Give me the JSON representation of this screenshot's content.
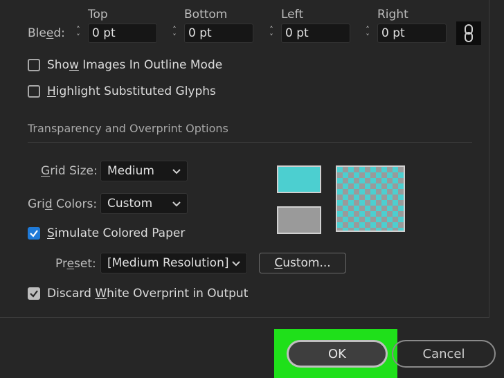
{
  "bleed": {
    "label": "Bleed:",
    "columns": [
      {
        "header": "Top",
        "value": "0 pt"
      },
      {
        "header": "Bottom",
        "value": "0 pt"
      },
      {
        "header": "Left",
        "value": "0 pt"
      },
      {
        "header": "Right",
        "value": "0 pt"
      }
    ],
    "link_icon": "chain-link-icon"
  },
  "options": {
    "show_images": {
      "label": "Show Images In Outline Mode",
      "checked": false
    },
    "highlight_glyphs": {
      "label": "Highlight Substituted Glyphs",
      "checked": false
    }
  },
  "transparency": {
    "title": "Transparency and Overprint Options",
    "grid_size": {
      "label": "Grid Size:",
      "value": "Medium"
    },
    "grid_colors": {
      "label": "Grid Colors:",
      "value": "Custom"
    },
    "simulate_paper": {
      "label": "Simulate Colored Paper",
      "checked": true
    },
    "preset": {
      "label": "Preset:",
      "value": "[Medium Resolution]"
    },
    "custom_button": "Custom...",
    "discard_white": {
      "label": "Discard White Overprint in Output",
      "checked": true
    },
    "swatch_top_color": "#4ccfd0",
    "swatch_bottom_color": "#9a9a9a"
  },
  "footer": {
    "ok_label": "OK",
    "cancel_label": "Cancel"
  }
}
